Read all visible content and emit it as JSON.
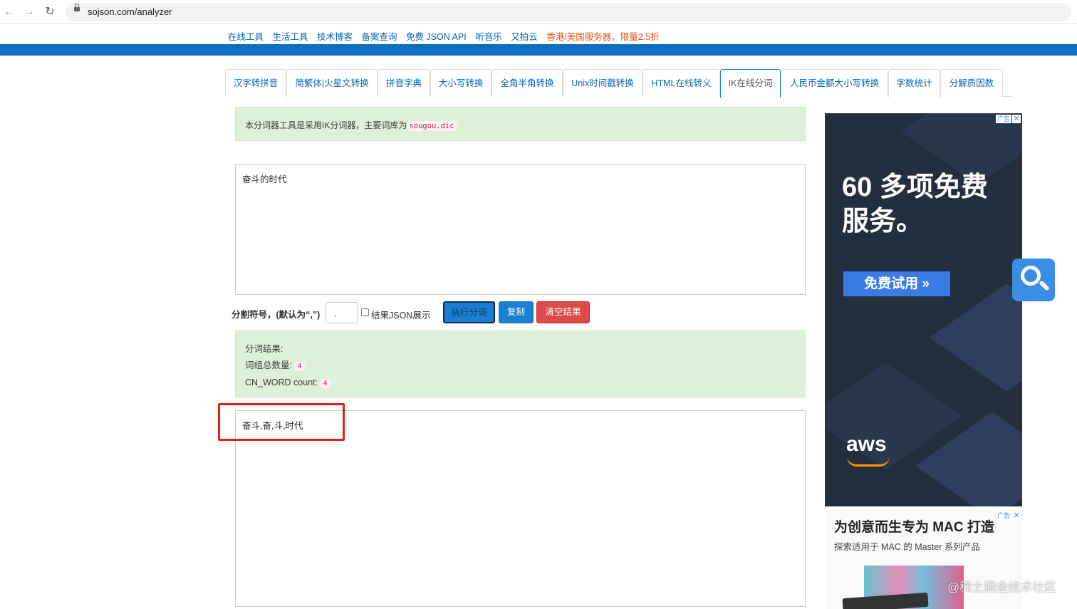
{
  "browser": {
    "url": "sojson.com/analyzer"
  },
  "top_links": [
    {
      "label": "在线工具"
    },
    {
      "label": "生活工具"
    },
    {
      "label": "技术博客"
    },
    {
      "label": "备案查询"
    },
    {
      "label": "免费 JSON API"
    },
    {
      "label": "听音乐"
    },
    {
      "label": "又拍云"
    },
    {
      "label": "香港/美国服务器，限量2.5折"
    }
  ],
  "tabs": [
    {
      "label": "汉字转拼音"
    },
    {
      "label": "简繁体|火星文转换"
    },
    {
      "label": "拼音字典"
    },
    {
      "label": "大小写转换"
    },
    {
      "label": "全角半角转换"
    },
    {
      "label": "Unix时间戳转换"
    },
    {
      "label": "HTML在线转义"
    },
    {
      "label": "IK在线分词"
    },
    {
      "label": "人民币金额大小写转换"
    },
    {
      "label": "字数统计"
    },
    {
      "label": "分解质因数"
    }
  ],
  "notice": {
    "text": "本分词器工具是采用IK分词器，主要词库为",
    "dict": "sougou.dic"
  },
  "input_text": "奋斗的时代",
  "controls": {
    "separator_label": "分割符号，(默认为“,”)",
    "separator_value": ",",
    "json_checkbox_label": "结果JSON展示",
    "run_button": "执行分词",
    "copy_button": "复制",
    "clear_button": "清空结果"
  },
  "result": {
    "heading": "分词结果:",
    "total_label": "词组总数量:",
    "total_value": "4",
    "cn_label": "CN_WORD count:",
    "cn_value": "4"
  },
  "output_text": "奋斗,奋,斗,时代",
  "ad1": {
    "title_line1": "60 多项免费",
    "title_line2": "服务。",
    "cta": "免费试用 »",
    "brand": "aws",
    "tag": "广告"
  },
  "ad2": {
    "title": "为创意而生专为 MAC 打造",
    "subtitle": "探索适用于 MAC 的 Master 系列产品",
    "tag": "广告"
  },
  "watermark": "@稀土掘金技术社区"
}
